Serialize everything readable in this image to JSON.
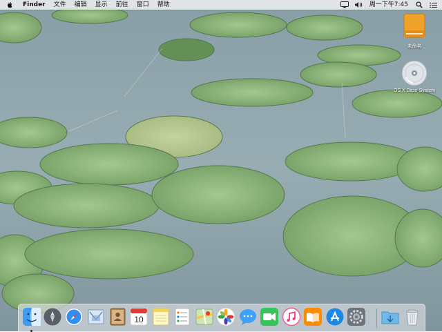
{
  "menubar": {
    "apple_icon": "apple-logo-icon",
    "app_name": "Finder",
    "menus": [
      "文件",
      "编辑",
      "显示",
      "前往",
      "窗口",
      "帮助"
    ],
    "clock": "周一下午7:45",
    "status_icons": [
      "airplay-icon",
      "volume-icon",
      "spotlight-icon",
      "notification-center-icon"
    ]
  },
  "desktop": {
    "icons": [
      {
        "label": "未命名",
        "icon": "external-drive-icon"
      },
      {
        "label": "OS X Base System",
        "icon": "dvd-disc-icon"
      }
    ]
  },
  "dock": {
    "apps": [
      {
        "name": "Finder",
        "icon": "finder-icon",
        "running": true
      },
      {
        "name": "Launchpad",
        "icon": "launchpad-icon",
        "running": false
      },
      {
        "name": "Safari",
        "icon": "safari-icon",
        "running": false
      },
      {
        "name": "Mail",
        "icon": "mail-icon",
        "running": false
      },
      {
        "name": "Contacts",
        "icon": "contacts-icon",
        "running": false
      },
      {
        "name": "Calendar",
        "icon": "calendar-icon",
        "running": false,
        "badge_text": "10"
      },
      {
        "name": "Notes",
        "icon": "notes-icon",
        "running": false
      },
      {
        "name": "Reminders",
        "icon": "reminders-icon",
        "running": false
      },
      {
        "name": "Maps",
        "icon": "maps-icon",
        "running": false
      },
      {
        "name": "Photos",
        "icon": "photos-icon",
        "running": false
      },
      {
        "name": "Messages",
        "icon": "messages-icon",
        "running": false
      },
      {
        "name": "FaceTime",
        "icon": "facetime-icon",
        "running": false
      },
      {
        "name": "iTunes",
        "icon": "itunes-icon",
        "running": false
      },
      {
        "name": "iBooks",
        "icon": "ibooks-icon",
        "running": false
      },
      {
        "name": "App Store",
        "icon": "app-store-icon",
        "running": false
      },
      {
        "name": "System Preferences",
        "icon": "system-preferences-icon",
        "running": false
      },
      {
        "name": "Downloads",
        "icon": "downloads-folder-icon",
        "running": false
      },
      {
        "name": "Trash",
        "icon": "trash-icon",
        "running": false
      }
    ]
  },
  "colors": {
    "water": "#8fa3ac",
    "water_dark": "#6b8490",
    "lily_pad": "#8fba7a",
    "lily_pad_dark": "#5f8f4e",
    "accent_blue": "#1e88e5"
  }
}
